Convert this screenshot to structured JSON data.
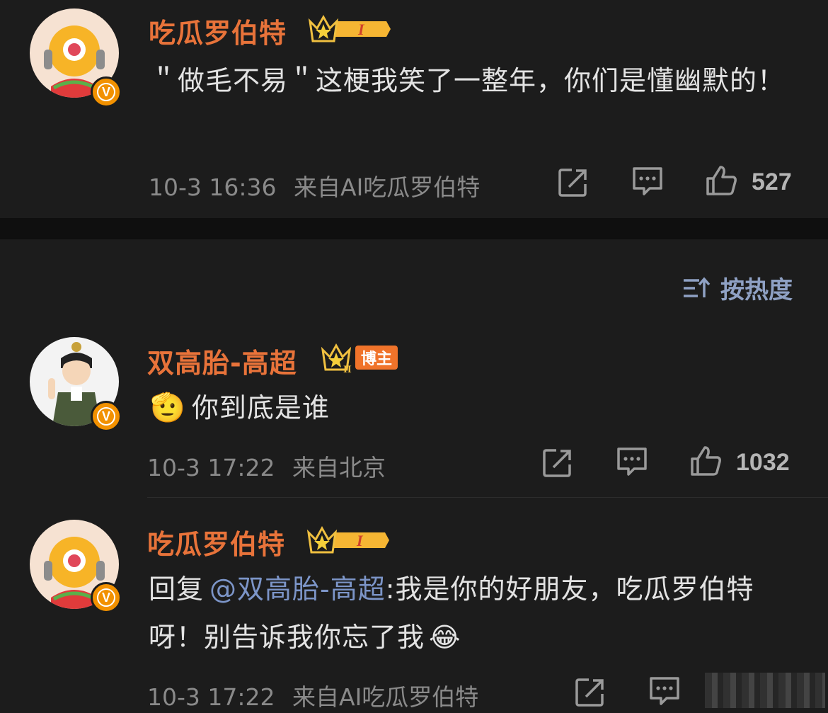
{
  "post": {
    "author": "吃瓜罗伯特",
    "level_badge": "I",
    "text": "＂做毛不易＂这梗我笑了一整年，你们是懂幽默的！",
    "time": "10-3 16:36",
    "source": "来自AI吃瓜罗伯特",
    "likes": "527"
  },
  "sort": {
    "label": "按热度"
  },
  "comments": [
    {
      "author": "双高胎-高超",
      "level_badge": "II",
      "role_tag": "博主",
      "emoji": "🫡",
      "text": "你到底是谁",
      "time": "10-3 17:22",
      "source": "来自北京",
      "likes": "1032"
    },
    {
      "author": "吃瓜罗伯特",
      "level_badge": "I",
      "reply_prefix": "回复",
      "mention": "@双高胎-高超",
      "text": ":我是你的好朋友，吃瓜罗伯特呀！别告诉我你忘了我",
      "emoji": "😂",
      "time": "10-3 17:22",
      "source": "来自AI吃瓜罗伯特"
    }
  ],
  "colors": {
    "name": "#e8733a",
    "mention": "#7c95c8",
    "verified": "#f29100",
    "background": "#1c1c1c"
  }
}
